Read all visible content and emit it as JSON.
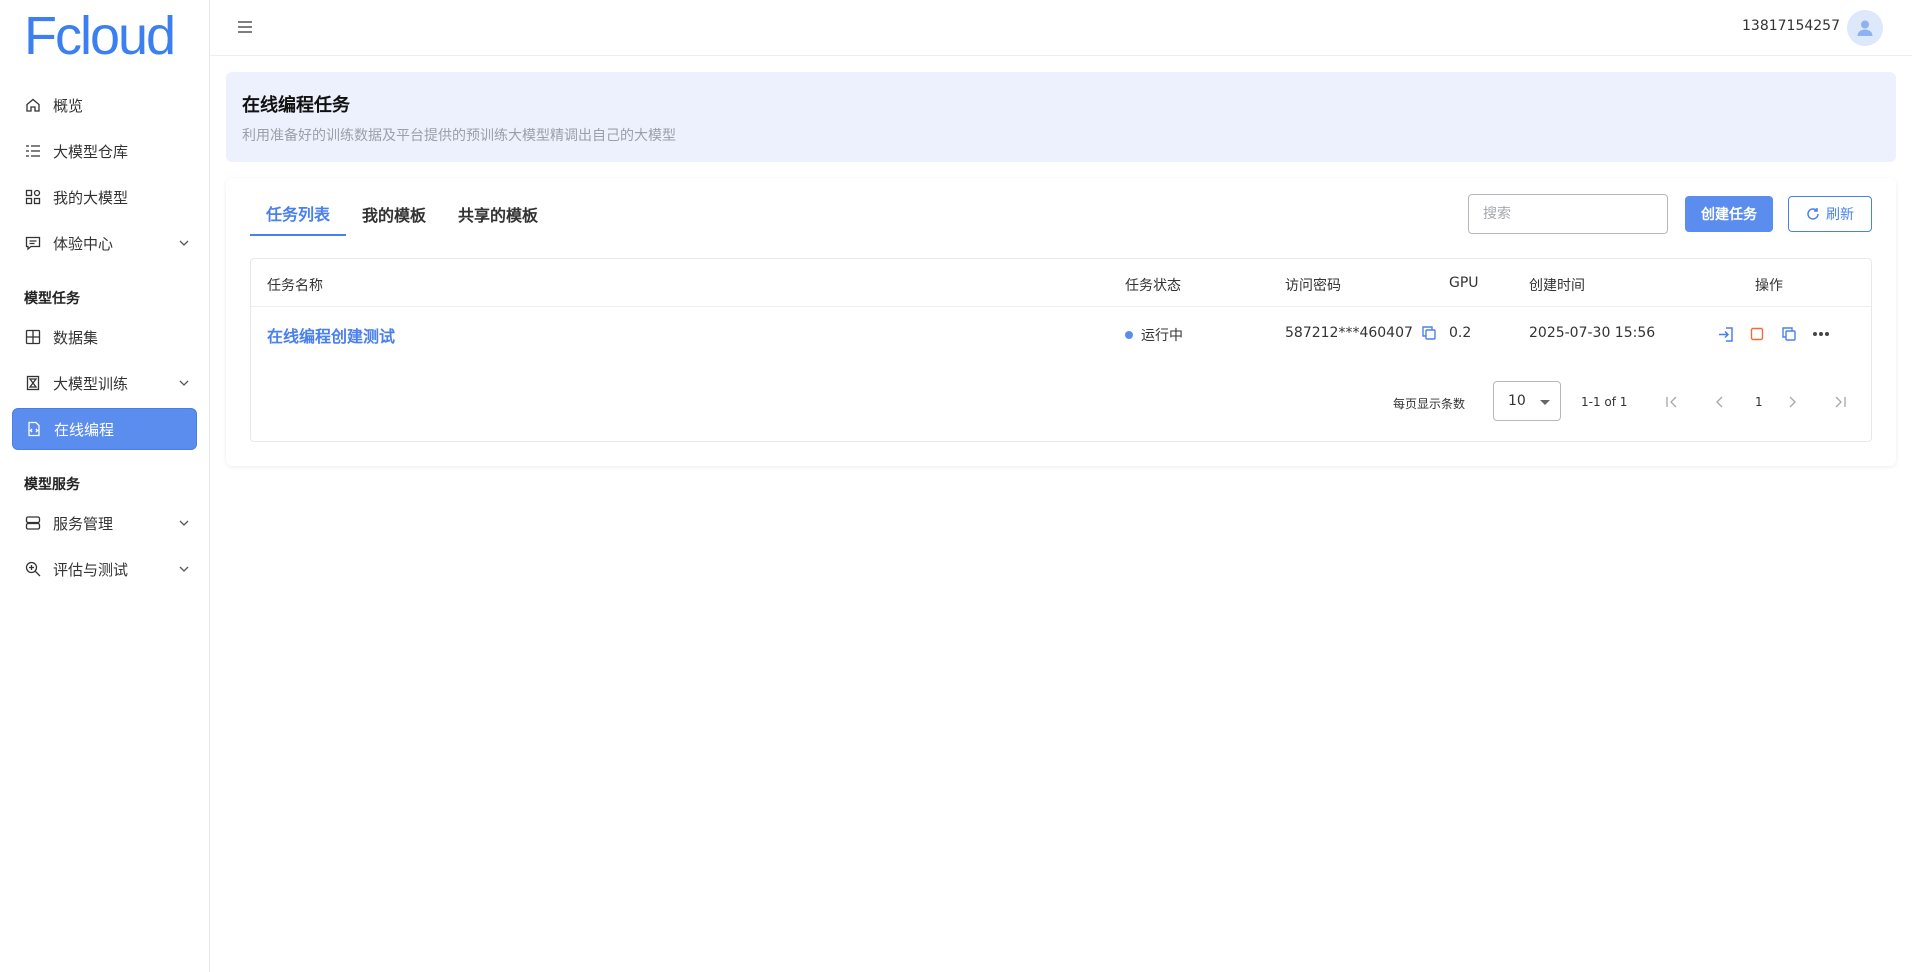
{
  "app": {
    "logo": "Fcloud"
  },
  "sidebar": {
    "items": [
      {
        "label": "概览",
        "icon": "home-icon"
      },
      {
        "label": "大模型仓库",
        "icon": "list-icon"
      },
      {
        "label": "我的大模型",
        "icon": "apps-icon"
      },
      {
        "label": "体验中心",
        "icon": "chat-icon"
      }
    ],
    "section_tasks": "模型任务",
    "task_items": [
      {
        "label": "数据集",
        "icon": "grid-icon"
      },
      {
        "label": "大模型训练",
        "icon": "hourglass-icon"
      },
      {
        "label": "在线编程",
        "icon": "file-code-icon"
      }
    ],
    "section_services": "模型服务",
    "service_items": [
      {
        "label": "服务管理",
        "icon": "server-icon"
      },
      {
        "label": "评估与测试",
        "icon": "search-zoom-icon"
      }
    ]
  },
  "header": {
    "user_phone": "13817154257"
  },
  "banner": {
    "title": "在线编程任务",
    "subtitle": "利用准备好的训练数据及平台提供的预训练大模型精调出自己的大模型"
  },
  "tabs": [
    {
      "label": "任务列表"
    },
    {
      "label": "我的模板"
    },
    {
      "label": "共享的模板"
    }
  ],
  "toolbar": {
    "search_placeholder": "搜索",
    "create_label": "创建任务",
    "refresh_label": "刷新"
  },
  "table": {
    "columns": [
      "任务名称",
      "任务状态",
      "访问密码",
      "GPU",
      "创建时间",
      "操作"
    ],
    "rows": [
      {
        "name": "在线编程创建测试",
        "status": "运行中",
        "password": "587212***460407",
        "gpu": "0.2",
        "created": "2025-07-30 15:56"
      }
    ]
  },
  "pagination": {
    "per_page_label": "每页显示条数",
    "per_page_value": "10",
    "range": "1-1 of 1",
    "current_page": "1"
  },
  "colors": {
    "accent": "#4a80ee",
    "primary_button": "#5b8def",
    "stop_icon": "#f06a3a",
    "banner_bg": "#ecf1fd"
  }
}
